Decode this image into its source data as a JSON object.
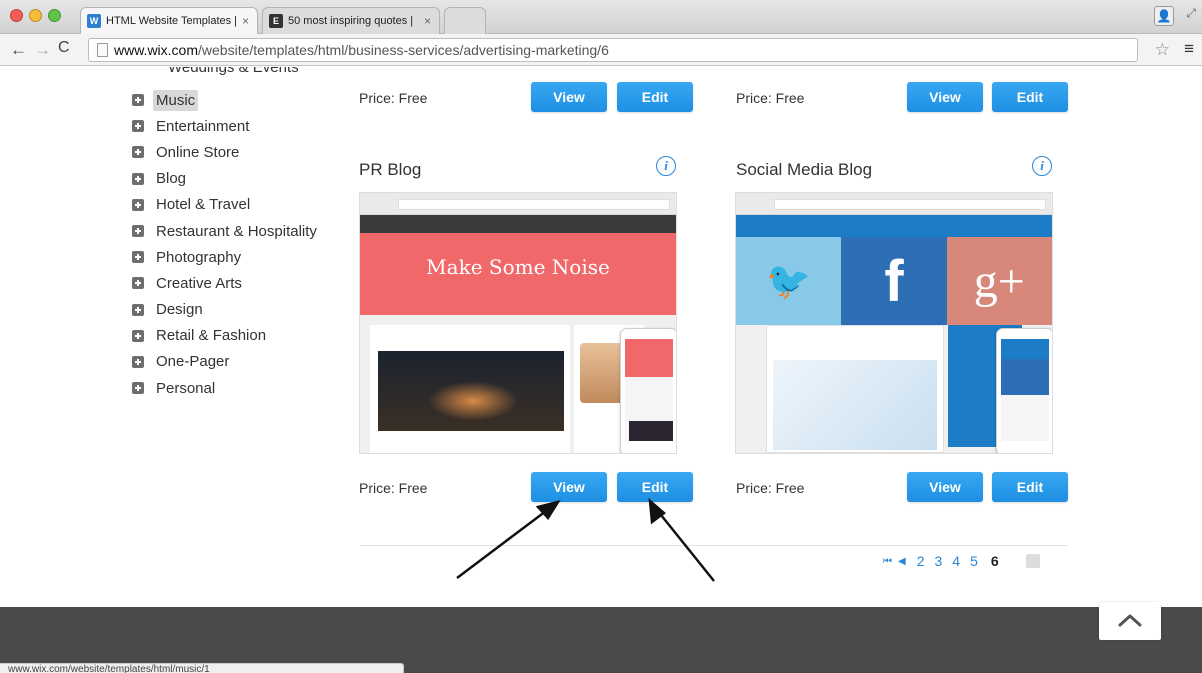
{
  "browser": {
    "tabs": [
      {
        "title": "HTML Website Templates |",
        "close": "×"
      },
      {
        "title": "50 most inspiring quotes |",
        "close": "×"
      }
    ],
    "url_host": "www.wix.com",
    "url_path": "/website/templates/html/business-services/advertising-marketing/6",
    "favicons": {
      "wix": "W",
      "quote": "E"
    },
    "icons": {
      "back": "←",
      "forward": "→",
      "reload": "C",
      "star": "☆",
      "menu": "≡",
      "profile": "👤",
      "fullscreen": "⤢"
    }
  },
  "sidebar": {
    "cut_off_item": "Weddings & Events",
    "categories": [
      {
        "label": "Music",
        "selected": true
      },
      {
        "label": "Entertainment"
      },
      {
        "label": "Online Store"
      },
      {
        "label": "Blog"
      },
      {
        "label": "Hotel & Travel"
      },
      {
        "label": "Restaurant & Hospitality"
      },
      {
        "label": "Photography"
      },
      {
        "label": "Creative Arts"
      },
      {
        "label": "Design"
      },
      {
        "label": "Retail & Fashion"
      },
      {
        "label": "One-Pager"
      },
      {
        "label": "Personal"
      }
    ]
  },
  "templates": {
    "top_left": {
      "price": "Price: Free",
      "view": "View",
      "edit": "Edit"
    },
    "top_right": {
      "price": "Price: Free",
      "view": "View",
      "edit": "Edit"
    },
    "pr_blog": {
      "title": "PR Blog",
      "info": "i",
      "preview_hero": "Make Some Noise",
      "price": "Price: Free",
      "view": "View",
      "edit": "Edit"
    },
    "social_media_blog": {
      "title": "Social Media Blog",
      "info": "i",
      "price": "Price: Free",
      "view": "View",
      "edit": "Edit"
    }
  },
  "pagination": {
    "first": "⏮",
    "prev": "◀",
    "pages": [
      "2",
      "3",
      "4",
      "5"
    ],
    "current": "6"
  },
  "status_bar": "www.wix.com/website/templates/html/music/1",
  "colors": {
    "button": "#1e8fe2",
    "footer": "#4a4a4a",
    "info": "#2a86d6"
  }
}
